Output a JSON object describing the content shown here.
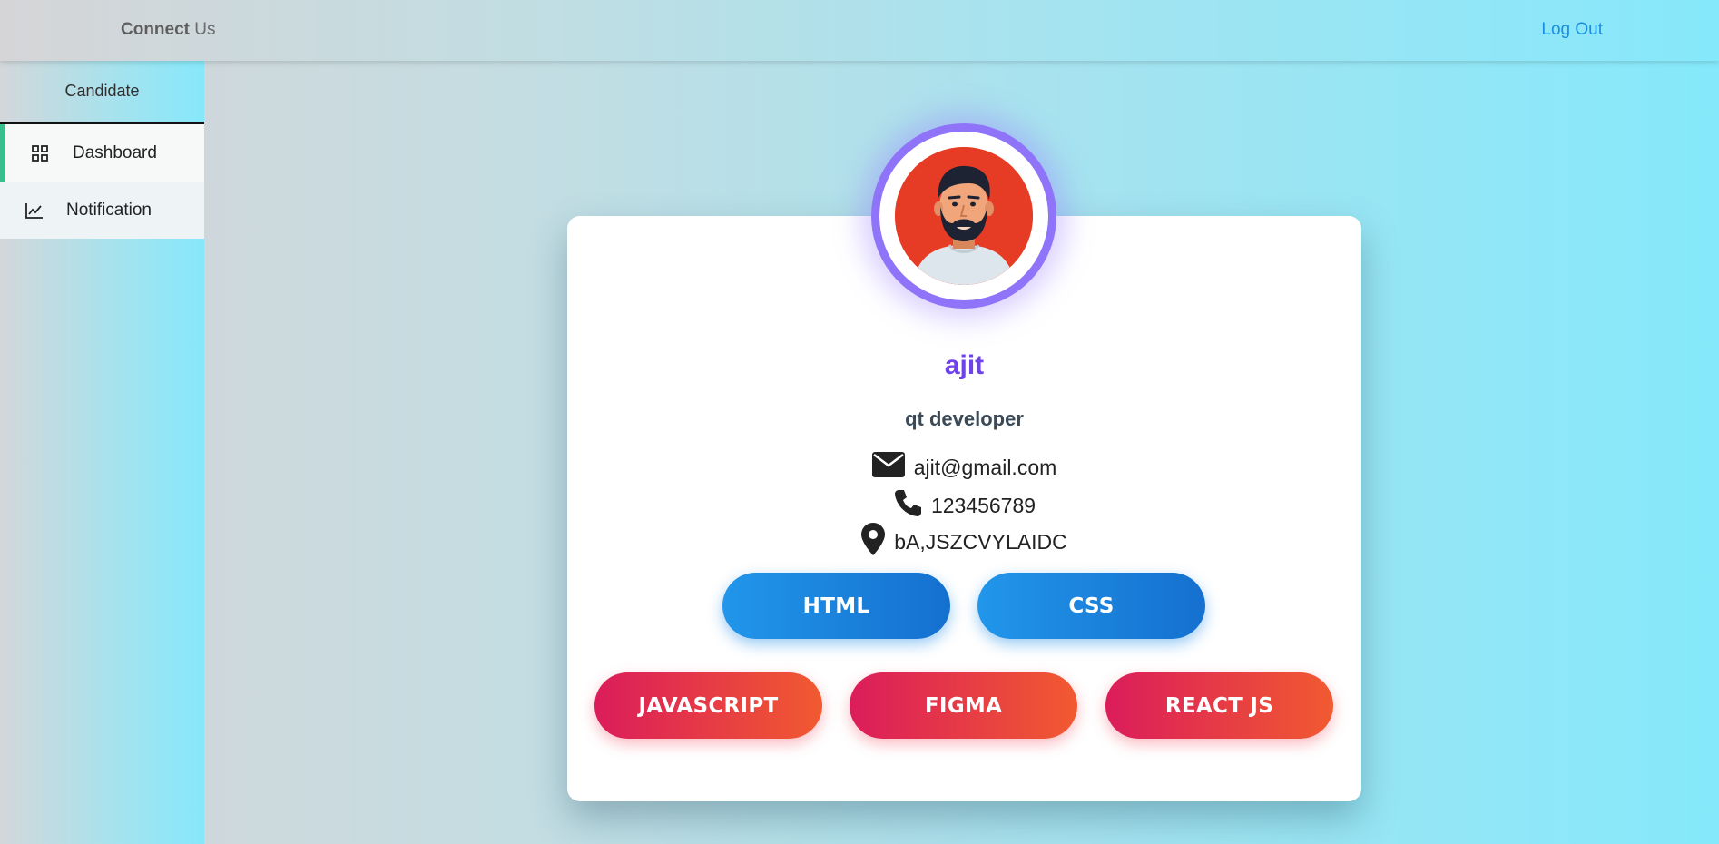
{
  "header": {
    "brand_bold": "Connect",
    "brand_rest": " Us",
    "logout_label": "Log Out"
  },
  "sidebar": {
    "title": "Candidate",
    "items": [
      {
        "label": "Dashboard",
        "icon": "grid-icon",
        "active": true
      },
      {
        "label": "Notification",
        "icon": "line-chart-icon",
        "active": false
      }
    ]
  },
  "profile": {
    "name": "ajit",
    "role": "qt developer",
    "email": "ajit@gmail.com",
    "phone": "123456789",
    "location": "bA,JSZCVYLAIDC",
    "avatar_icon": "man-avatar-icon",
    "skills_primary": [
      "HTML",
      "CSS"
    ],
    "skills_secondary": [
      "JAVASCRIPT",
      "FIGMA",
      "REACT JS"
    ]
  },
  "colors": {
    "accent_purple": "#8f73f8",
    "name_color": "#7043ea",
    "link_blue": "#1a8fe0",
    "active_marker": "#37c08e"
  }
}
